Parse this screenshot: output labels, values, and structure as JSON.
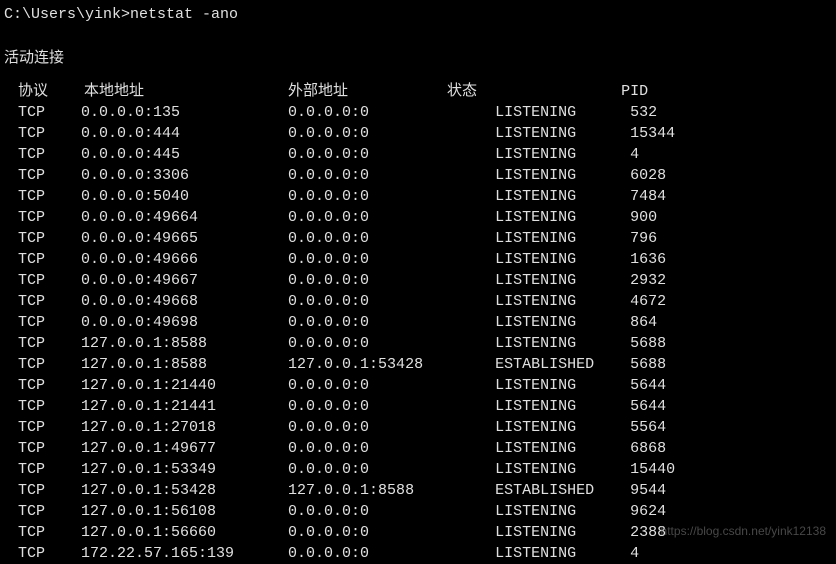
{
  "prompt": "C:\\Users\\yink>netstat -ano",
  "section_title": "活动连接",
  "headers": {
    "proto": "协议",
    "local_addr": "本地地址",
    "foreign_addr": "外部地址",
    "state": "状态",
    "pid": "PID"
  },
  "rows": [
    {
      "proto": "TCP",
      "local": "0.0.0.0:135",
      "foreign": "0.0.0.0:0",
      "state": "LISTENING",
      "pid": "532"
    },
    {
      "proto": "TCP",
      "local": "0.0.0.0:444",
      "foreign": "0.0.0.0:0",
      "state": "LISTENING",
      "pid": "15344"
    },
    {
      "proto": "TCP",
      "local": "0.0.0.0:445",
      "foreign": "0.0.0.0:0",
      "state": "LISTENING",
      "pid": "4"
    },
    {
      "proto": "TCP",
      "local": "0.0.0.0:3306",
      "foreign": "0.0.0.0:0",
      "state": "LISTENING",
      "pid": "6028"
    },
    {
      "proto": "TCP",
      "local": "0.0.0.0:5040",
      "foreign": "0.0.0.0:0",
      "state": "LISTENING",
      "pid": "7484"
    },
    {
      "proto": "TCP",
      "local": "0.0.0.0:49664",
      "foreign": "0.0.0.0:0",
      "state": "LISTENING",
      "pid": "900"
    },
    {
      "proto": "TCP",
      "local": "0.0.0.0:49665",
      "foreign": "0.0.0.0:0",
      "state": "LISTENING",
      "pid": "796"
    },
    {
      "proto": "TCP",
      "local": "0.0.0.0:49666",
      "foreign": "0.0.0.0:0",
      "state": "LISTENING",
      "pid": "1636"
    },
    {
      "proto": "TCP",
      "local": "0.0.0.0:49667",
      "foreign": "0.0.0.0:0",
      "state": "LISTENING",
      "pid": "2932"
    },
    {
      "proto": "TCP",
      "local": "0.0.0.0:49668",
      "foreign": "0.0.0.0:0",
      "state": "LISTENING",
      "pid": "4672"
    },
    {
      "proto": "TCP",
      "local": "0.0.0.0:49698",
      "foreign": "0.0.0.0:0",
      "state": "LISTENING",
      "pid": "864"
    },
    {
      "proto": "TCP",
      "local": "127.0.0.1:8588",
      "foreign": "0.0.0.0:0",
      "state": "LISTENING",
      "pid": "5688"
    },
    {
      "proto": "TCP",
      "local": "127.0.0.1:8588",
      "foreign": "127.0.0.1:53428",
      "state": "ESTABLISHED",
      "pid": "5688"
    },
    {
      "proto": "TCP",
      "local": "127.0.0.1:21440",
      "foreign": "0.0.0.0:0",
      "state": "LISTENING",
      "pid": "5644"
    },
    {
      "proto": "TCP",
      "local": "127.0.0.1:21441",
      "foreign": "0.0.0.0:0",
      "state": "LISTENING",
      "pid": "5644"
    },
    {
      "proto": "TCP",
      "local": "127.0.0.1:27018",
      "foreign": "0.0.0.0:0",
      "state": "LISTENING",
      "pid": "5564"
    },
    {
      "proto": "TCP",
      "local": "127.0.0.1:49677",
      "foreign": "0.0.0.0:0",
      "state": "LISTENING",
      "pid": "6868"
    },
    {
      "proto": "TCP",
      "local": "127.0.0.1:53349",
      "foreign": "0.0.0.0:0",
      "state": "LISTENING",
      "pid": "15440"
    },
    {
      "proto": "TCP",
      "local": "127.0.0.1:53428",
      "foreign": "127.0.0.1:8588",
      "state": "ESTABLISHED",
      "pid": "9544"
    },
    {
      "proto": "TCP",
      "local": "127.0.0.1:56108",
      "foreign": "0.0.0.0:0",
      "state": "LISTENING",
      "pid": "9624"
    },
    {
      "proto": "TCP",
      "local": "127.0.0.1:56660",
      "foreign": "0.0.0.0:0",
      "state": "LISTENING",
      "pid": "2388"
    },
    {
      "proto": "TCP",
      "local": "172.22.57.165:139",
      "foreign": "0.0.0.0:0",
      "state": "LISTENING",
      "pid": "4"
    }
  ],
  "watermark": "https://blog.csdn.net/yink12138"
}
